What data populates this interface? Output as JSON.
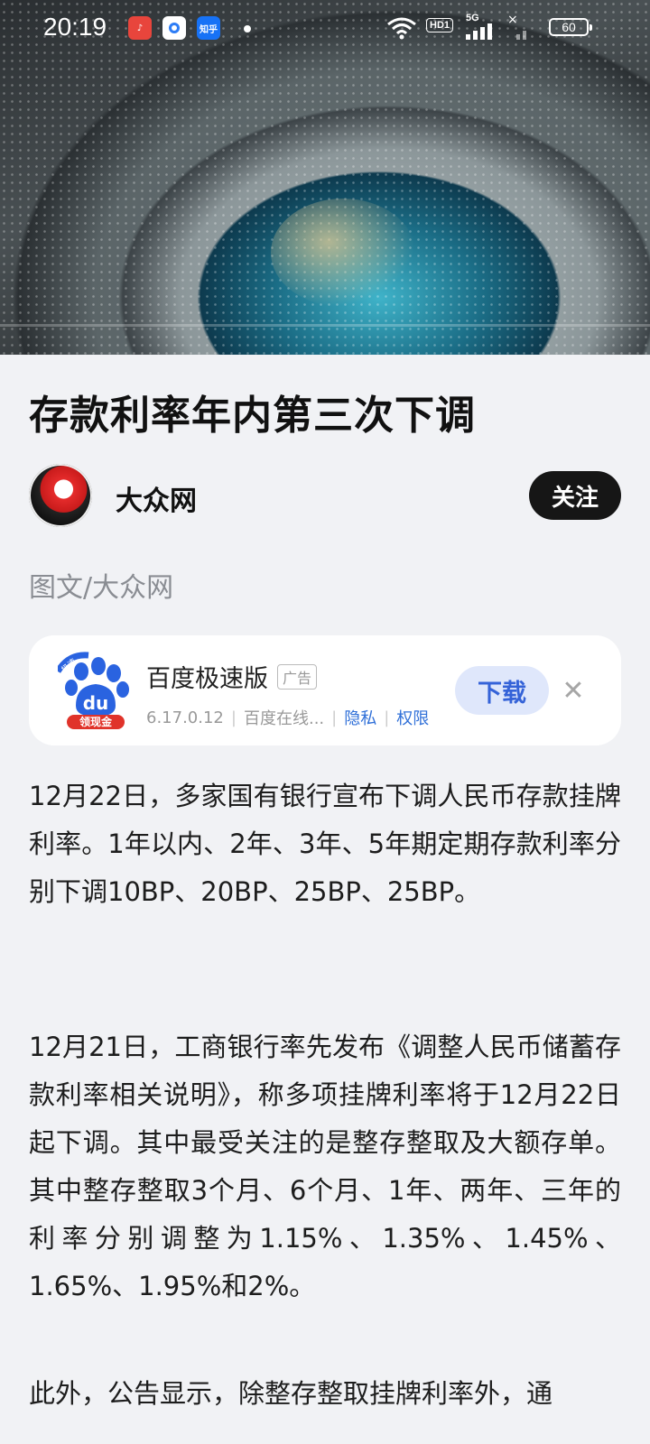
{
  "status_bar": {
    "time": "20:19",
    "notification_icons": [
      "douyin-icon",
      "browser-icon",
      "zhihu-icon"
    ],
    "zhihu_label": "知乎",
    "network": "5G",
    "hd_label": "HD1",
    "battery": "60"
  },
  "hero": {
    "progress_fraction": 0.0
  },
  "article": {
    "title": "存款利率年内第三次下调",
    "author": {
      "name": "大众网",
      "follow_label": "关注"
    },
    "byline": "图文/大众网",
    "paragraphs": [
      "12月22日，多家国有银行宣布下调人民币存款挂牌利率。1年以内、2年、3年、5年期定期存款利率分别下调10BP、20BP、25BP、25BP。",
      "12月21日，工商银行率先发布《调整人民币储蓄存款利率相关说明》，称多项挂牌利率将于12月22日起下调。其中最受关注的是整存整取及大额存单。其中整存整取3个月、6个月、1年、两年、三年的利率分别调整为1.15%、1.35%、1.45%、1.65%、1.95%和2%。",
      "此外，公告显示，除整存整取挂牌利率外，通"
    ]
  },
  "ad": {
    "app_name": "百度极速版",
    "tag": "广告",
    "version": "6.17.0.12",
    "developer": "百度在线...",
    "privacy_label": "隐私",
    "permission_label": "权限",
    "download_label": "下载",
    "logo_top_text": "极速",
    "logo_mid_text": "du",
    "logo_bottom_text": "领现金",
    "accent_color": "#3563d8"
  }
}
